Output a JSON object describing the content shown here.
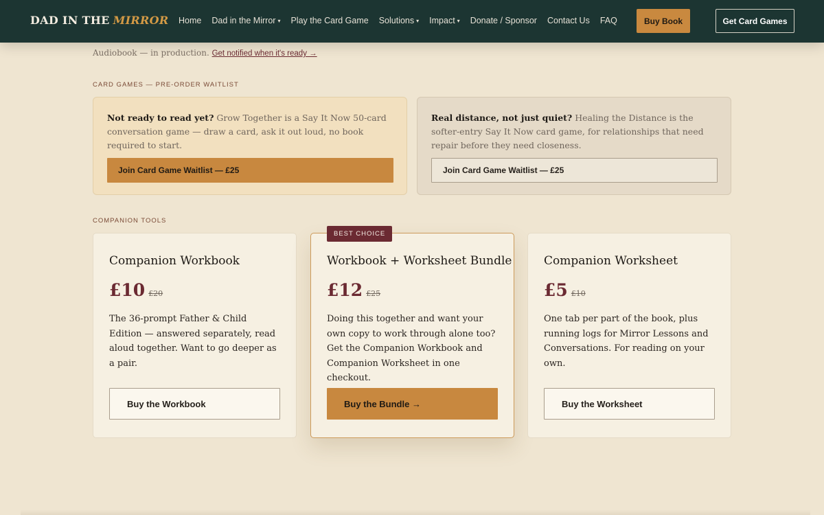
{
  "nav": {
    "logo_main": "DAD IN THE",
    "logo_accent": "MIRROR",
    "links": [
      {
        "label": "Home",
        "dropdown": false
      },
      {
        "label": "Dad in the Mirror",
        "dropdown": true
      },
      {
        "label": "Play the Card Game",
        "dropdown": false
      },
      {
        "label": "Solutions",
        "dropdown": true
      },
      {
        "label": "Impact",
        "dropdown": true
      },
      {
        "label": "Donate / Sponsor",
        "dropdown": false
      },
      {
        "label": "Contact Us",
        "dropdown": false
      },
      {
        "label": "FAQ",
        "dropdown": false
      }
    ],
    "caret_glyph": "▾",
    "buy_book": "Buy Book",
    "get_card_games": "Get Card Games"
  },
  "audiobook": {
    "text": "Audiobook — in production.",
    "link": "Get notified when it's ready →"
  },
  "card_games": {
    "section_label": "CARD GAMES — PRE-ORDER WAITLIST",
    "items": [
      {
        "lead": "Not ready to read yet?",
        "body": " Grow Together is a Say It Now 50-card conversation game — draw a card, ask it out loud, no book required to start.",
        "button": "Join Card Game Waitlist — £25"
      },
      {
        "lead": "Real distance, not just quiet?",
        "body": " Healing the Distance is the softer-entry Say It Now card game, for relationships that need repair before they need closeness.",
        "button": "Join Card Game Waitlist — £25"
      }
    ]
  },
  "companion": {
    "section_label": "COMPANION TOOLS",
    "products": [
      {
        "title": "Companion Workbook",
        "price": "£10",
        "was": "£20",
        "desc": "The 36-prompt Father & Child Edition — answered separately, read aloud together. Want to go deeper as a pair.",
        "button": "Buy the Workbook"
      },
      {
        "badge": "BEST CHOICE",
        "title": "Workbook + Worksheet Bundle",
        "price": "£12",
        "was": "£25",
        "desc": "Doing this together and want your own copy to work through alone too? Get the Companion Workbook and Companion Worksheet in one checkout.",
        "button": "Buy the Bundle →"
      },
      {
        "title": "Companion Worksheet",
        "price": "£5",
        "was": "£10",
        "desc": "One tab per part of the book, plus running logs for Mirror Lessons and Conversations. For reading on your own.",
        "button": "Buy the Worksheet"
      }
    ]
  },
  "colors": {
    "nav_bg": "#1c3532",
    "accent": "#c8883f",
    "burgundy": "#6b2a32",
    "page_bg": "#efe5d1"
  }
}
